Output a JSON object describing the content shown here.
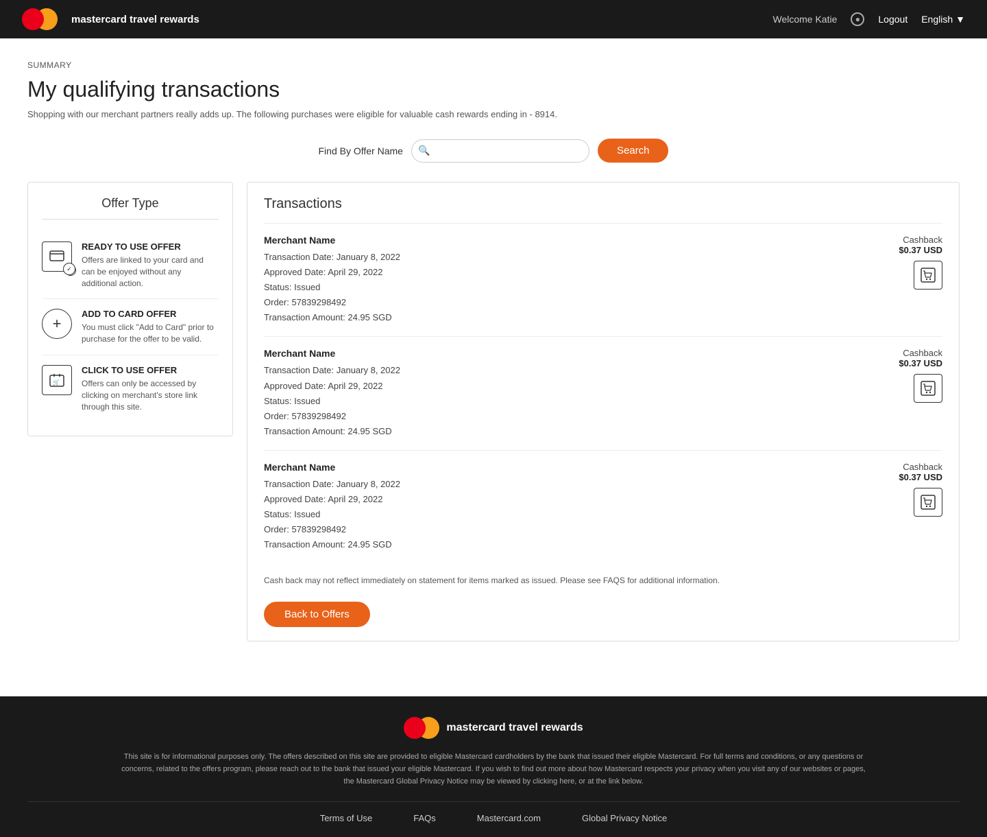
{
  "header": {
    "brand_name": "mastercard",
    "brand_suffix": " travel rewards",
    "welcome_text": "Welcome Katie",
    "logout_label": "Logout",
    "language_label": "English"
  },
  "breadcrumb": "SUMMARY",
  "page_title": "My qualifying transactions",
  "page_subtitle": "Shopping with our merchant partners really adds up. The following purchases were eligible for valuable cash rewards ending in - 8914.",
  "search": {
    "find_label": "Find By Offer Name",
    "placeholder": "",
    "button_label": "Search"
  },
  "offer_type_panel": {
    "title": "Offer Type",
    "items": [
      {
        "icon": "💳",
        "title": "READY TO USE OFFER",
        "description": "Offers are linked to your card and can be enjoyed without any additional action."
      },
      {
        "icon": "+",
        "title": "ADD TO CARD OFFER",
        "description": "You must click \"Add to Card\" prior to purchase for the offer to be valid."
      },
      {
        "icon": "🛒",
        "title": "CLICK TO USE OFFER",
        "description": "Offers can only be accessed by clicking on merchant's store link through this site."
      }
    ]
  },
  "transactions_panel": {
    "title": "Transactions",
    "rows": [
      {
        "merchant_name": "Merchant Name",
        "cashback_label": "Cashback",
        "cashback_amount": "$0.37 USD",
        "transaction_date": "Transaction Date: January 8, 2022",
        "approved_date": "Approved Date: April 29, 2022",
        "status": "Status: Issued",
        "order": "Order: 57839298492",
        "transaction_amount": "Transaction Amount: 24.95 SGD"
      },
      {
        "merchant_name": "Merchant Name",
        "cashback_label": "Cashback",
        "cashback_amount": "$0.37 USD",
        "transaction_date": "Transaction Date: January 8, 2022",
        "approved_date": "Approved Date: April 29, 2022",
        "status": "Status: Issued",
        "order": "Order: 57839298492",
        "transaction_amount": "Transaction Amount: 24.95 SGD"
      },
      {
        "merchant_name": "Merchant Name",
        "cashback_label": "Cashback",
        "cashback_amount": "$0.37 USD",
        "transaction_date": "Transaction Date: January 8, 2022",
        "approved_date": "Approved Date: April 29, 2022",
        "status": "Status: Issued",
        "order": "Order: 57839298492",
        "transaction_amount": "Transaction Amount: 24.95 SGD"
      }
    ],
    "note": "Cash back may not reflect immediately on statement for items marked as issued. Please see FAQS for additional information.",
    "back_button_label": "Back to Offers"
  },
  "footer": {
    "brand_name": "mastercard",
    "brand_suffix": " travel rewards",
    "disclaimer": "This site is for informational purposes only. The offers described on this site are provided to eligible Mastercard cardholders by the bank that issued their eligible Mastercard. For full terms and conditions, or any questions or concerns, related to the offers program, please reach out to the bank that issued your eligible Mastercard. If you wish to find out more about how Mastercard respects your privacy when you visit any of our websites or pages, the Mastercard Global Privacy Notice may be viewed by clicking here, or at the link below.",
    "links": [
      {
        "label": "Terms of Use"
      },
      {
        "label": "FAQs"
      },
      {
        "label": "Mastercard.com"
      },
      {
        "label": "Global Privacy Notice"
      }
    ]
  }
}
